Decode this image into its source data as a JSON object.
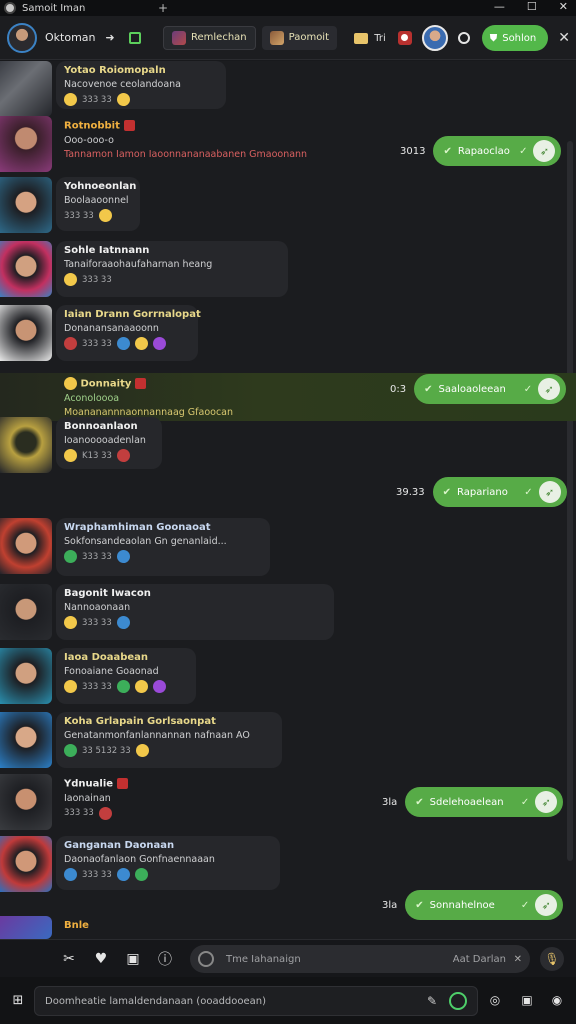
{
  "window": {
    "title": "Samoit Iman",
    "new_tab": "+",
    "controls": [
      "—",
      "☐",
      "✕"
    ]
  },
  "header": {
    "user_name": "Oktoman",
    "tabs": [
      {
        "label": "Remlechan"
      },
      {
        "label": "Paomoit"
      }
    ],
    "status_text": "Tri",
    "primary_button": "Sohlon"
  },
  "messages": [
    {
      "name": "Yotao Roiomopaln",
      "text": "Nacovenoe ceolandoana",
      "meta": "333 33"
    },
    {
      "name": "Rotnobbit",
      "text": "Ooo-ooo-o",
      "text2": "Tannamon Iamon Iaoonnananaabanen Gmaoonann",
      "meta": ""
    },
    {
      "name": "Yohnoeonlan",
      "text": "Boolaaoonnel",
      "meta": "333 33"
    },
    {
      "name": "Sohle Iatnnann",
      "text": "Tanaiforaaohaufaharnan heang",
      "meta": "333 33"
    },
    {
      "name": "Iaian Drann Gorrnalopat",
      "text": "Donanansanaaoonn",
      "meta": "333 33"
    },
    {
      "name": "Donnaity",
      "text": "Aconoloooa",
      "text2": "Moananannnaonnannaag Gfaoocan",
      "meta": ""
    },
    {
      "name": "Bonnoanlaon",
      "text": "Ioanooooadenlan",
      "meta": "K13 33"
    },
    {
      "name": "Wraphamhiman Goonaoat",
      "text": "Sokfonsandeaolan Gn genanlaid...",
      "meta": "333 33"
    },
    {
      "name": "Bagonit Iwacon",
      "text": "Nannoaonaan",
      "meta": "333 33"
    },
    {
      "name": "Iaoa Doaabean",
      "text": "Fonoaiane Goaonad",
      "meta": "333 33"
    },
    {
      "name": "Koha Grlapain Gorlsaonpat",
      "text": "Genatanmonfanlannannan nafnaan AO",
      "meta": "33 5132 33"
    },
    {
      "name": "Ydnualie",
      "text": "Iaonainan",
      "meta": "333 33"
    },
    {
      "name": "Ganganan Daonaan",
      "text": "Daonaofanlaon Gonfnaennaaan",
      "meta": "333 33"
    },
    {
      "name": "Bnle",
      "text": "",
      "meta": ""
    }
  ],
  "outgoing": [
    {
      "time": "3013",
      "label": "Rapaoclao"
    },
    {
      "time": "0:3",
      "label": "Saaloaoleean"
    },
    {
      "time": "39.33",
      "label": "Rapariano"
    },
    {
      "time": "3la",
      "label": "Sdelehoaelean"
    },
    {
      "time": "3la",
      "label": "Sonnahelnoe"
    }
  ],
  "input": {
    "placeholder": "Tme Iahanaign",
    "right_text": "Aat Darlan"
  },
  "compose": {
    "placeholder": "Doomheatie lamaldendanaan (ooaddooean)"
  },
  "colors": {
    "accent_green": "#57ab47",
    "background": "#1b1c1f",
    "bubble": "#26272b",
    "name_yellow": "#e8d88a"
  },
  "icons": [
    "search-icon",
    "send-icon",
    "checkmark-icon",
    "microphone-icon",
    "camera-icon",
    "info-icon",
    "heart-icon",
    "tools-icon",
    "pen-icon",
    "windows-icon"
  ]
}
